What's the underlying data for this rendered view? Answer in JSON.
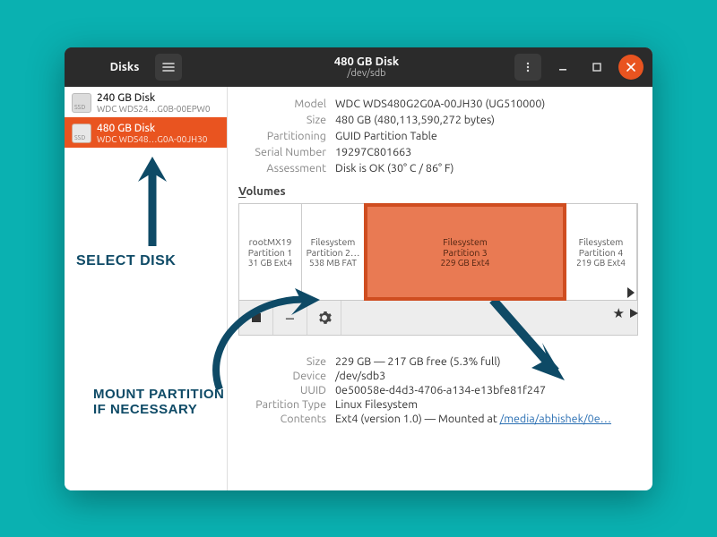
{
  "titlebar": {
    "left_title": "Disks",
    "center_title": "480 GB Disk",
    "center_subtitle": "/dev/sdb"
  },
  "sidebar": {
    "items": [
      {
        "name": "240 GB Disk",
        "model": "WDC WDS24…G0B-00EPW0",
        "ssd_label": "SSD"
      },
      {
        "name": "480 GB Disk",
        "model": "WDC WDS48…G0A-00JH30",
        "ssd_label": "SSD"
      }
    ]
  },
  "disk": {
    "model_label": "Model",
    "model": "WDC WDS480G2G0A-00JH30 (UG510000)",
    "size_label": "Size",
    "size": "480 GB (480,113,590,272 bytes)",
    "part_label": "Partitioning",
    "part": "GUID Partition Table",
    "serial_label": "Serial Number",
    "serial": "19297C801663",
    "assess_label": "Assessment",
    "assess": "Disk is OK (30° C / 86° F)"
  },
  "volumes_header_u": "V",
  "volumes_header_rest": "olumes",
  "segments": [
    {
      "name": "rootMX19",
      "part": "Partition 1",
      "size": "31 GB Ext4"
    },
    {
      "name": "Filesystem",
      "part": "Partition 2…",
      "size": "538 MB FAT"
    },
    {
      "name": "Filesystem",
      "part": "Partition 3",
      "size": "229 GB Ext4"
    },
    {
      "name": "Filesystem",
      "part": "Partition 4",
      "size": "219 GB Ext4"
    }
  ],
  "star": "★",
  "partition": {
    "size_label": "Size",
    "size": "229 GB — 217 GB free (5.3% full)",
    "device_label": "Device",
    "device": "/dev/sdb3",
    "uuid_label": "UUID",
    "uuid": "0e50058e-d4d3-4706-a134-e13bfe81f247",
    "ptype_label": "Partition Type",
    "ptype": "Linux Filesystem",
    "contents_label": "Contents",
    "contents_prefix": "Ext4 (version 1.0) — Mounted at ",
    "contents_link": "/media/abhishek/0e…"
  },
  "annotation": {
    "select_disk": "SELECT DISK",
    "mount": "MOUNT PARTITION\nIF NECESSARY"
  }
}
